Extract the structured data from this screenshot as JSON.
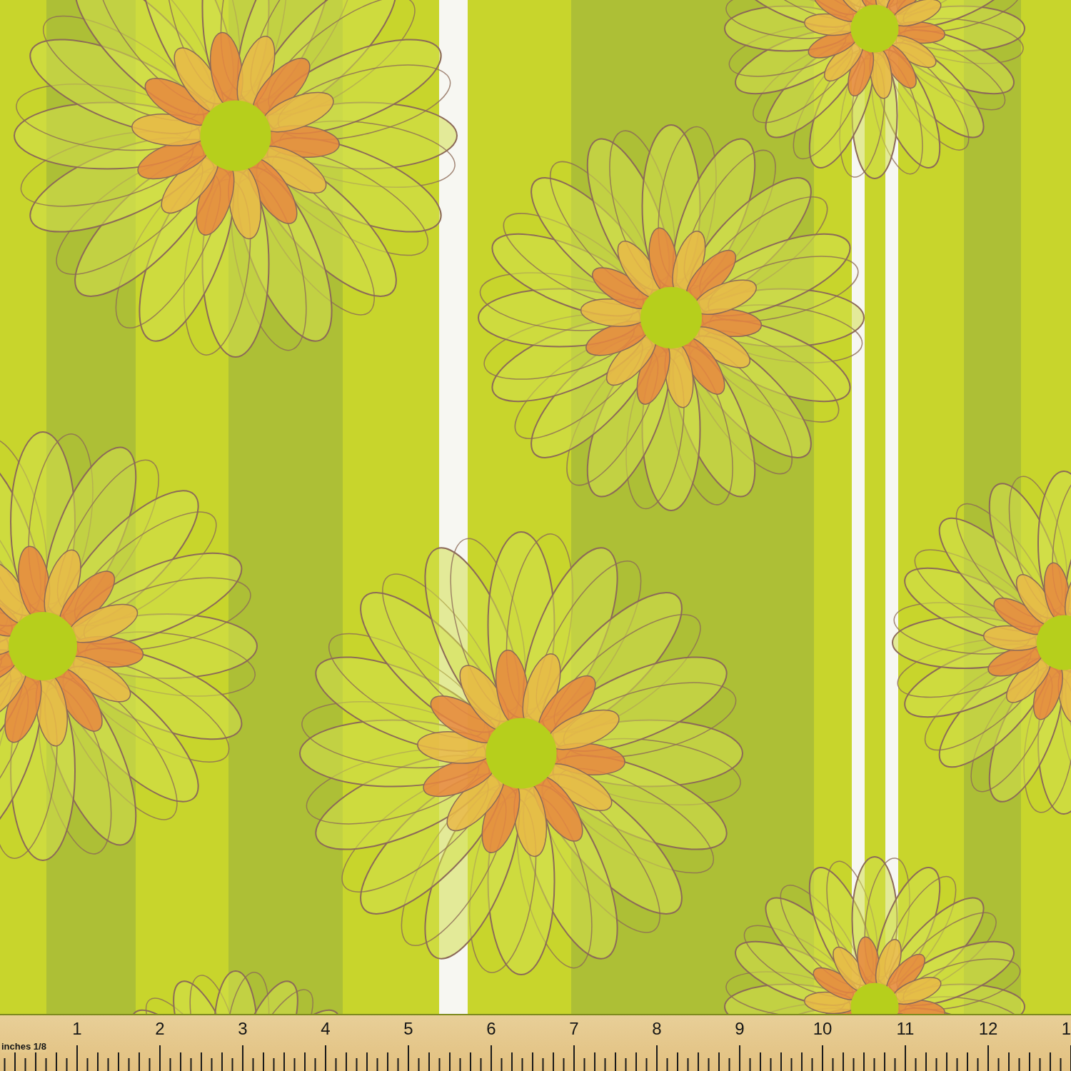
{
  "ruler": {
    "unit_label": "inches 1/8",
    "numbers": [
      "1",
      "2",
      "3",
      "4",
      "5",
      "6",
      "7",
      "8",
      "9",
      "10",
      "11",
      "12"
    ],
    "edge_number": "1"
  }
}
